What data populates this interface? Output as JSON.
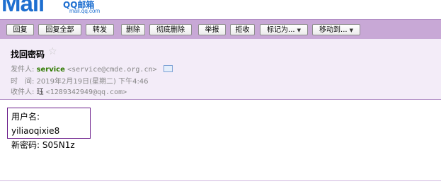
{
  "logo": {
    "big": "Mail",
    "brand": "QQ邮箱",
    "domain": "mail.qq.com"
  },
  "toolbar": {
    "buttons": [
      {
        "label": "回复"
      },
      {
        "label": "回复全部"
      },
      {
        "label": "转发"
      },
      {
        "label": "删除"
      },
      {
        "label": "彻底删除"
      },
      {
        "label": "举报"
      },
      {
        "label": "拒收"
      },
      {
        "label": "标记为..."
      },
      {
        "label": "移动到..."
      }
    ]
  },
  "email": {
    "subject": "找回密码",
    "sender_label": "发件人:",
    "sender_name": "service",
    "sender_email": "<service@cmde.org.cn>",
    "time_label": "时　间:",
    "time_value": "2019年2月19日(星期二) 下午4:46",
    "recipient_label": "收件人:",
    "recipient_name": "珏",
    "recipient_email": "<1289342949@qq.com>"
  },
  "body": {
    "line1": "用户名: yiliaoqixie8",
    "line2": "新密码: S05N1z"
  }
}
